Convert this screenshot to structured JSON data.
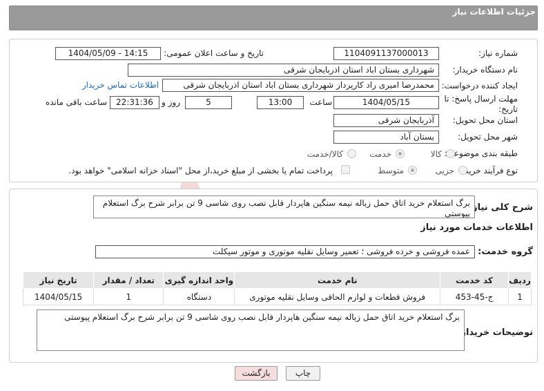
{
  "header": {
    "title": "جزئیات اطلاعات نیاز"
  },
  "fields": {
    "need_number_label": "شماره نیاز:",
    "need_number": "1104091137000013",
    "announce_label": "تاریخ و ساعت اعلان عمومی:",
    "announce_value": "1404/05/09 - 14:15",
    "buyer_org_label": "نام دستگاه خریدار:",
    "buyer_org": "شهرداری بستان اباد استان اذربایجان شرقی",
    "creator_label": "ایجاد کننده درخواست:",
    "creator": "محمدرضا امیری راد کارپرداز شهرداری بستان اباد استان اذربایجان شرقی",
    "contact_link": "اطلاعات تماس خریدار",
    "deadline_label_1": "مهلت ارسال پاسخ: تا",
    "deadline_label_2": "تاریخ:",
    "deadline_date": "1404/05/15",
    "time_label": "ساعت",
    "deadline_time": "13:00",
    "days_value": "5",
    "days_label": "روز و",
    "remaining_time": "22:31:36",
    "remaining_label": "ساعت باقی مانده",
    "province_label": "استان محل تحویل:",
    "province": "آذربایجان شرقی",
    "city_label": "شهر محل تحویل:",
    "city": "بستان آباد",
    "category_label": "طبقه بندی موضوعی:",
    "category_options": [
      "کالا",
      "خدمت",
      "کالا/خدمت"
    ],
    "category_selected": 1,
    "process_label": "نوع فرآیند خرید :",
    "process_options": [
      "جزیی",
      "متوسط"
    ],
    "process_selected": 1,
    "payment_note": "پرداخت تمام یا بخشی از مبلغ خرید،از محل \"اسناد خزانه اسلامی\" خواهد بود."
  },
  "summary": {
    "label": "شرح کلی نیاز:",
    "text": "برگ استعلام خرید اتاق حمل زباله نیمه سنگین هاپردار قابل نصب روی شاسی 9 تن  برابر شرح برگ استعلام پیوستی"
  },
  "services": {
    "section_title": "اطلاعات خدمات مورد نیاز",
    "group_label": "گروه خدمت:",
    "group_value": "عمده فروشی و خرده فروشی ؛ تعمیر وسایل نقلیه موتوری و موتور سیکلت",
    "table": {
      "headers": [
        "ردیف",
        "کد خدمت",
        "نام خدمت",
        "واحد اندازه گیری",
        "تعداد / مقدار",
        "تاریخ نیاز"
      ],
      "rows": [
        [
          "1",
          "ج-45-453",
          "فروش قطعات و لوازم الحاقی وسایل نقلیه موتوری",
          "دستگاه",
          "1",
          "1404/05/15"
        ]
      ]
    },
    "buyer_notes_label": "توضیحات خریدار:",
    "buyer_notes": "برگ استعلام خرید اتاق حمل زباله نیمه سنگین هاپردار قابل نصب روی شاسی 9 تن  برابر شرح برگ استعلام پیوستی"
  },
  "buttons": {
    "print": "چاپ",
    "back": "بازگشت"
  },
  "watermark": "AriaTender.neT",
  "colors": {
    "header": "#9a9a9a",
    "link": "#1a6bbf",
    "back_button": "#f7dede",
    "print_button": "#f2f2f2"
  }
}
